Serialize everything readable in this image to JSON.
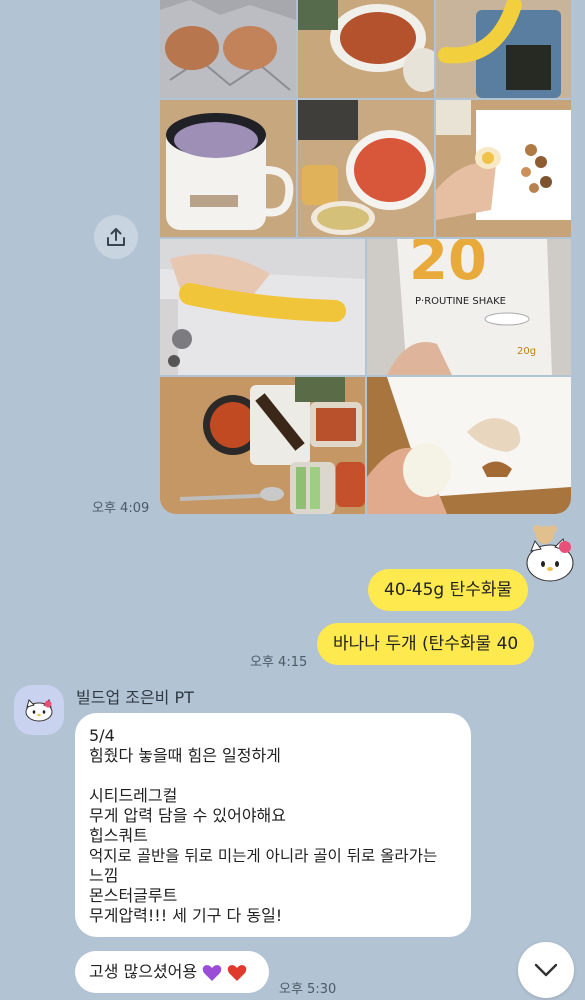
{
  "photo_message": {
    "time": "오후 4:09",
    "share_icon": "share-icon",
    "photos": [
      {
        "name": "photo-eggs-foil"
      },
      {
        "name": "photo-stew-bowl"
      },
      {
        "name": "photo-banana-seaweed"
      },
      {
        "name": "photo-oat-mug"
      },
      {
        "name": "photo-tteokbokki"
      },
      {
        "name": "photo-egg-nuts"
      },
      {
        "name": "photo-banana-hand"
      },
      {
        "name": "photo-protein-shake",
        "brand_text": "P·ROUTINE SHAKE",
        "big_text": "20",
        "sub_text": "20g"
      },
      {
        "name": "photo-meal-tray"
      },
      {
        "name": "photo-peeled-egg"
      }
    ]
  },
  "my_messages": [
    {
      "text": "40-45g 탄수화물"
    },
    {
      "text": "바나나 두개 (탄수화물 40",
      "time": "오후 4:15"
    }
  ],
  "trainer": {
    "name": "빌드업 조은비 PT",
    "avatar_icon": "hello-kitty-icon",
    "message_lines": [
      "5/4",
      "힘줬다 놓을때 힘은 일정하게",
      "",
      "시티드레그컬",
      "무게 압력 담을 수 있어야해요",
      "힙스쿼트",
      "억지로 골반을 뒤로 미는게 아니라 골이 뒤로 올라가는",
      "느낌",
      "몬스터글루트",
      "무게압력!!! 세 기구 다 동일!"
    ],
    "reply_text": "고생 많으셨어용",
    "reply_time": "오후 5:30"
  },
  "colors": {
    "background": "#b2c3d4",
    "my_bubble": "#fee94e",
    "their_bubble": "#ffffff",
    "heart_purple": "#9b4dd8",
    "heart_red": "#e0392e"
  },
  "scroll_down_icon": "chevron-down-icon"
}
